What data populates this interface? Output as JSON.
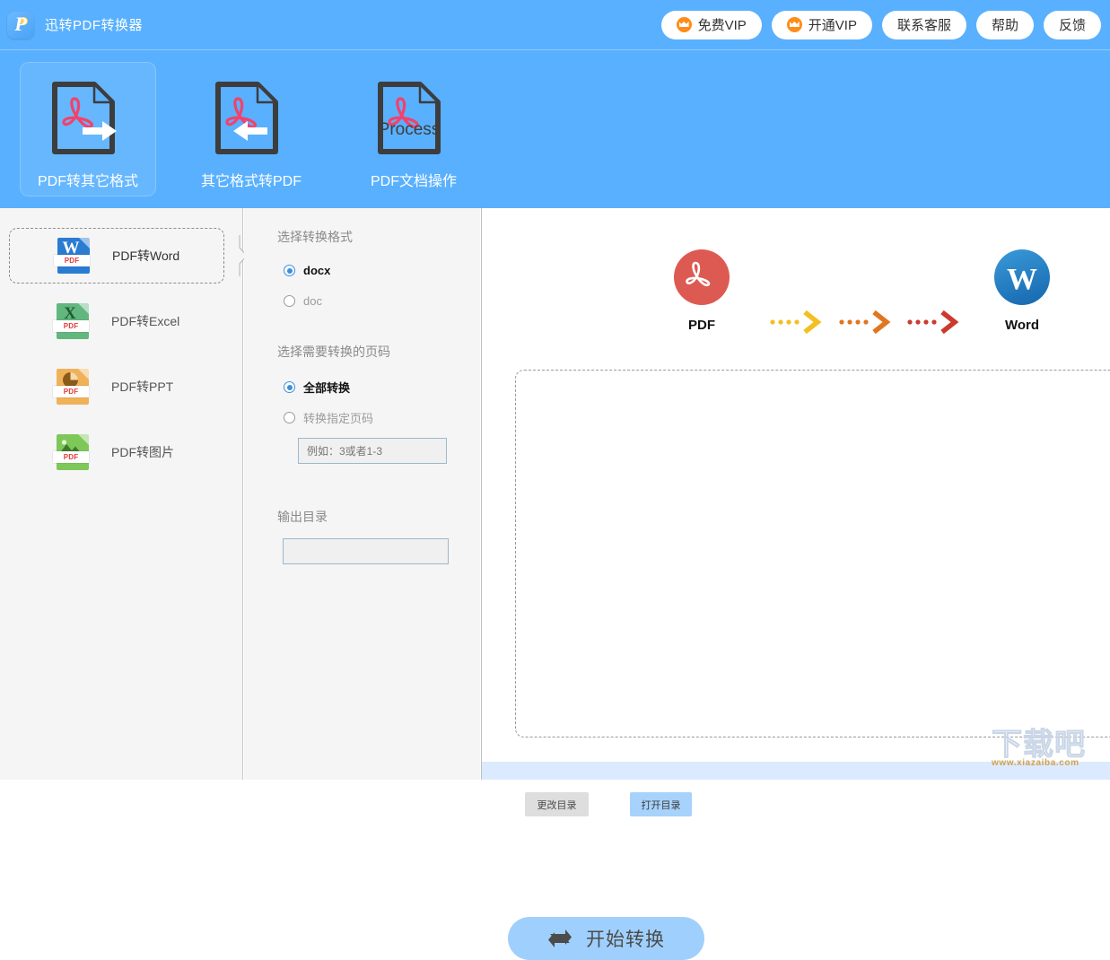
{
  "app": {
    "title": "迅转PDF转换器",
    "logo_icon": "app-logo-p-icon",
    "brand_blue": "#59b0fe"
  },
  "header": {
    "buttons": [
      {
        "label": "免费VIP",
        "icon": "crown-icon",
        "has_icon": true
      },
      {
        "label": "开通VIP",
        "icon": "crown-icon",
        "has_icon": true
      },
      {
        "label": "联系客服",
        "icon": "",
        "has_icon": false
      },
      {
        "label": "帮助",
        "icon": "",
        "has_icon": false
      },
      {
        "label": "反馈",
        "icon": "",
        "has_icon": false
      }
    ]
  },
  "tabs": [
    {
      "label": "PDF转其它格式",
      "icon": "pdf-arrow-right-icon",
      "selected": true
    },
    {
      "label": "其它格式转PDF",
      "icon": "pdf-arrow-left-icon",
      "selected": false
    },
    {
      "label": "PDF文档操作",
      "icon": "pdf-process-icon",
      "badge_text": "Process",
      "selected": false
    }
  ],
  "sidebar": {
    "items": [
      {
        "label": "PDF转Word",
        "icon": "word-file-icon",
        "letter": "W",
        "color": "#2a7cd2",
        "tag": "PDF",
        "selected": true
      },
      {
        "label": "PDF转Excel",
        "icon": "excel-file-icon",
        "letter": "X",
        "color": "#62b77f",
        "tag": "PDF",
        "selected": false
      },
      {
        "label": "PDF转PPT",
        "icon": "ppt-file-icon",
        "letter": "",
        "color": "#f0b259",
        "tag": "PDF",
        "selected": false
      },
      {
        "label": "PDF转图片",
        "icon": "image-file-icon",
        "letter": "",
        "color": "#7ec85a",
        "tag": "PDF",
        "selected": false
      }
    ]
  },
  "options": {
    "format_section_title": "选择转换格式",
    "format_choices": [
      {
        "label": "docx",
        "selected": true
      },
      {
        "label": "doc",
        "selected": false
      }
    ],
    "pages_section_title": "选择需要转换的页码",
    "page_choices": [
      {
        "label": "全部转换",
        "selected": true
      },
      {
        "label": "转换指定页码",
        "selected": false
      }
    ],
    "page_input": {
      "value": "",
      "placeholder": "例如：3或者1-3"
    },
    "output_section_title": "输出目录",
    "output_input": {
      "value": "",
      "placeholder": ""
    },
    "change_dir_label": "更改目录",
    "open_dir_label": "打开目录",
    "start_label": "开始转换",
    "start_icon": "swap-arrows-icon"
  },
  "preview": {
    "flow": {
      "source": {
        "label": "PDF",
        "icon": "pdf-circle-icon",
        "color": "#dd5a52"
      },
      "target": {
        "label": "Word",
        "icon": "word-circle-icon",
        "color": "#1f7fc4"
      },
      "arrows": [
        {
          "color": "#f2c020",
          "icon": "dotted-arrow-icon"
        },
        {
          "color": "#e0761f",
          "icon": "dotted-arrow-icon"
        },
        {
          "color": "#cc3a2e",
          "icon": "dotted-arrow-icon"
        }
      ]
    },
    "dropzone": {
      "text": ""
    }
  },
  "watermark": {
    "text": "下载吧",
    "url": "www.xiazaiba.com"
  }
}
